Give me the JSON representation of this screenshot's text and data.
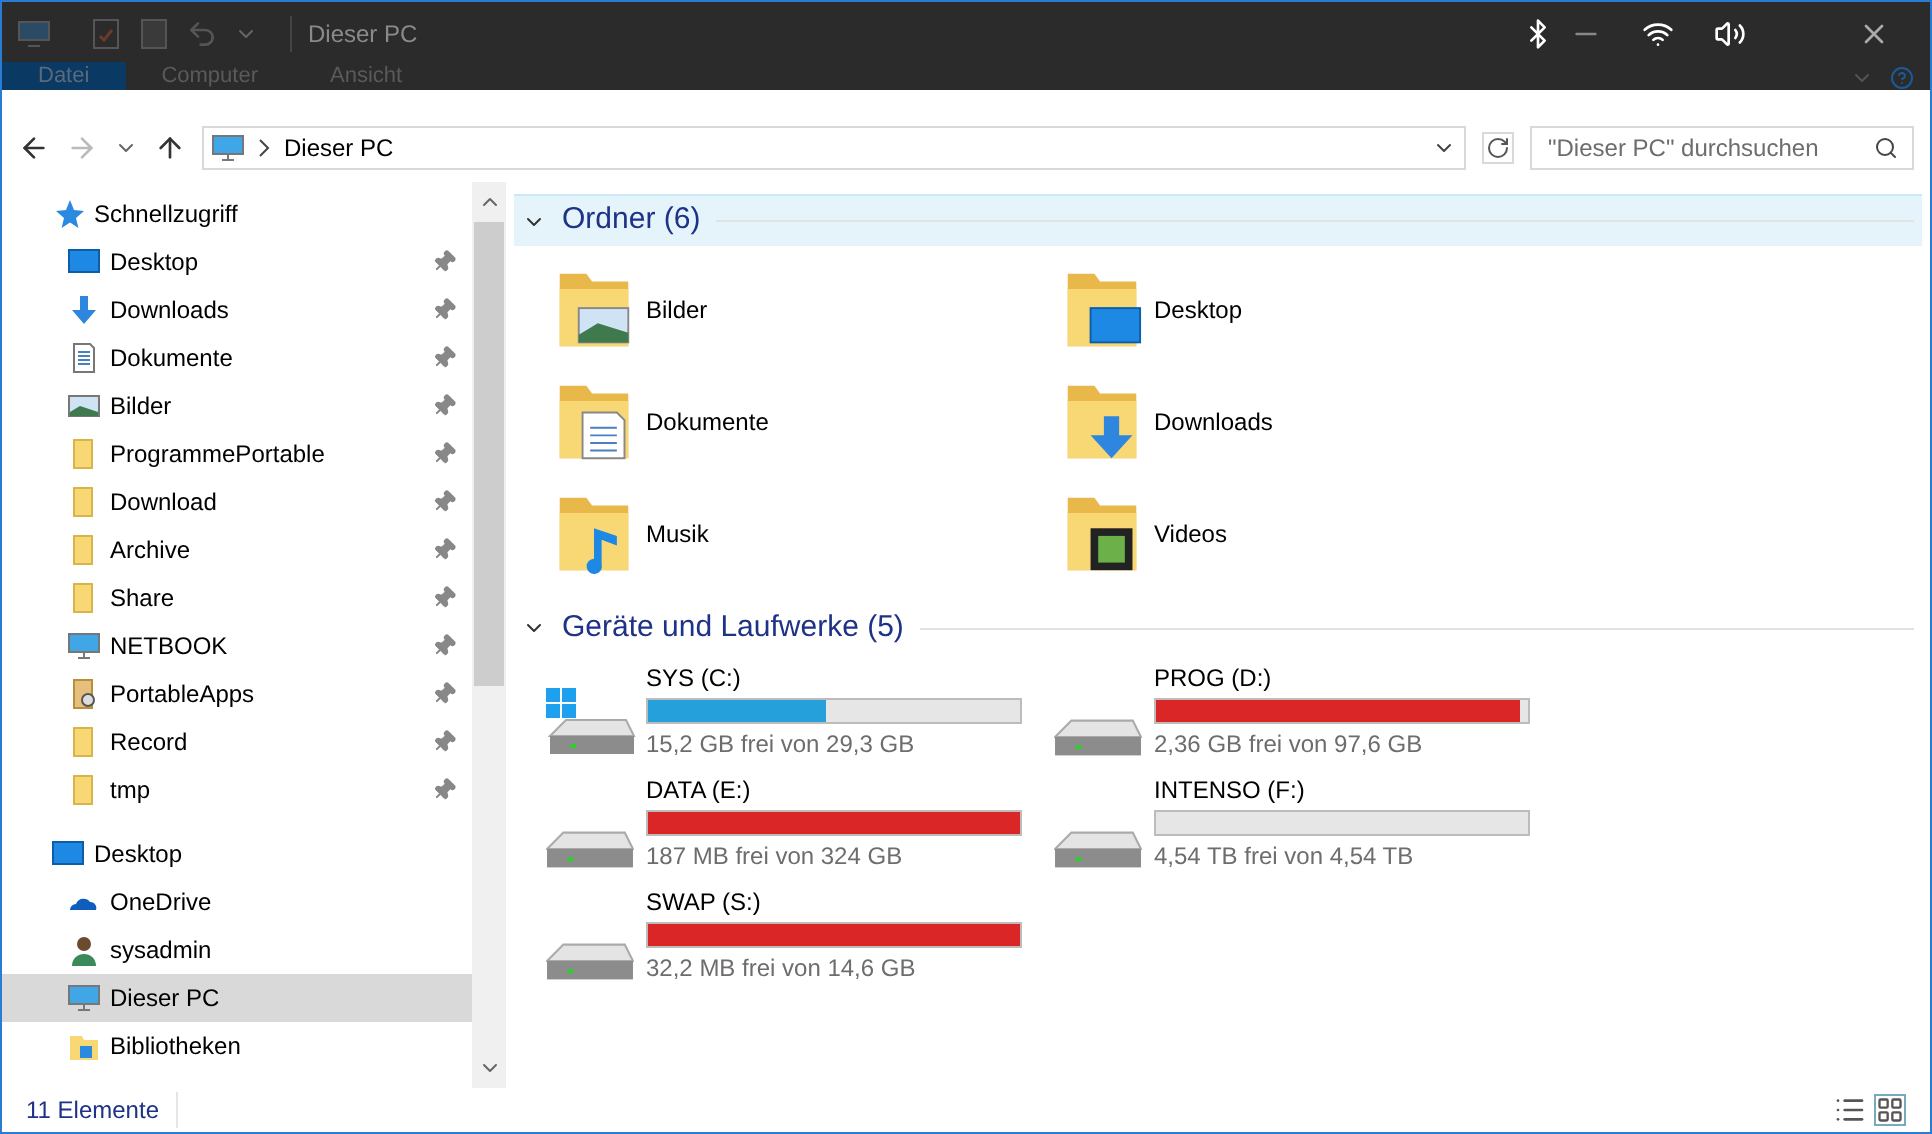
{
  "window": {
    "title": "Dieser PC"
  },
  "ribbon_tabs": [
    {
      "label": "Datei",
      "selected": true
    },
    {
      "label": "Computer",
      "selected": false
    },
    {
      "label": "Ansicht",
      "selected": false
    }
  ],
  "address": {
    "path": "Dieser PC",
    "search_placeholder": "\"Dieser PC\" durchsuchen"
  },
  "sidebar": {
    "items": [
      {
        "label": "Schnellzugriff",
        "kind": "star",
        "selected": false,
        "pinned": false,
        "children": [
          {
            "label": "Desktop",
            "kind": "desktop",
            "selected": false,
            "pinned": true
          },
          {
            "label": "Downloads",
            "kind": "downloads",
            "selected": false,
            "pinned": true
          },
          {
            "label": "Dokumente",
            "kind": "documents",
            "selected": false,
            "pinned": true
          },
          {
            "label": "Bilder",
            "kind": "pictures",
            "selected": false,
            "pinned": true
          },
          {
            "label": "ProgrammePortable",
            "kind": "folder",
            "selected": false,
            "pinned": true
          },
          {
            "label": "Download",
            "kind": "folder",
            "selected": false,
            "pinned": true
          },
          {
            "label": "Archive",
            "kind": "folder",
            "selected": false,
            "pinned": true
          },
          {
            "label": "Share",
            "kind": "folder",
            "selected": false,
            "pinned": true
          },
          {
            "label": "NETBOOK",
            "kind": "computer",
            "selected": false,
            "pinned": true
          },
          {
            "label": "PortableApps",
            "kind": "portable",
            "selected": false,
            "pinned": true
          },
          {
            "label": "Record",
            "kind": "folder",
            "selected": false,
            "pinned": true
          },
          {
            "label": "tmp",
            "kind": "folder",
            "selected": false,
            "pinned": true
          }
        ]
      },
      {
        "label": "Desktop",
        "kind": "desktop",
        "selected": false,
        "pinned": false,
        "children": [
          {
            "label": "OneDrive",
            "kind": "onedrive",
            "selected": false,
            "pinned": false
          },
          {
            "label": "sysadmin",
            "kind": "user",
            "selected": false,
            "pinned": false
          },
          {
            "label": "Dieser PC",
            "kind": "computer",
            "selected": true,
            "pinned": false
          },
          {
            "label": "Bibliotheken",
            "kind": "libraries",
            "selected": false,
            "pinned": false
          }
        ]
      }
    ]
  },
  "groups": [
    {
      "title": "Ordner (6)",
      "highlighted": true,
      "kind": "folders",
      "items": [
        {
          "name": "Bilder",
          "kind": "pictures"
        },
        {
          "name": "Desktop",
          "kind": "desktop"
        },
        {
          "name": "Dokumente",
          "kind": "documents"
        },
        {
          "name": "Downloads",
          "kind": "downloads"
        },
        {
          "name": "Musik",
          "kind": "music"
        },
        {
          "name": "Videos",
          "kind": "videos"
        }
      ]
    },
    {
      "title": "Geräte und Laufwerke (5)",
      "highlighted": false,
      "kind": "drives",
      "items": [
        {
          "name": "SYS (C:)",
          "system": true,
          "level": 0.48,
          "reading": "15,2 GB frei von 29,3 GB"
        },
        {
          "name": "PROG (D:)",
          "system": false,
          "level": 0.976,
          "reading": "2,36 GB frei von 97,6 GB"
        },
        {
          "name": "DATA (E:)",
          "system": false,
          "level": 0.999,
          "reading": "187 MB frei von 324 GB"
        },
        {
          "name": "INTENSO (F:)",
          "system": false,
          "level": 0.0,
          "reading": "4,54 TB frei von 4,54 TB"
        },
        {
          "name": "SWAP (S:)",
          "system": false,
          "level": 0.998,
          "reading": "32,2 MB frei von 14,6 GB"
        }
      ]
    }
  ],
  "status_bar": {
    "count": "11 Elemente"
  }
}
